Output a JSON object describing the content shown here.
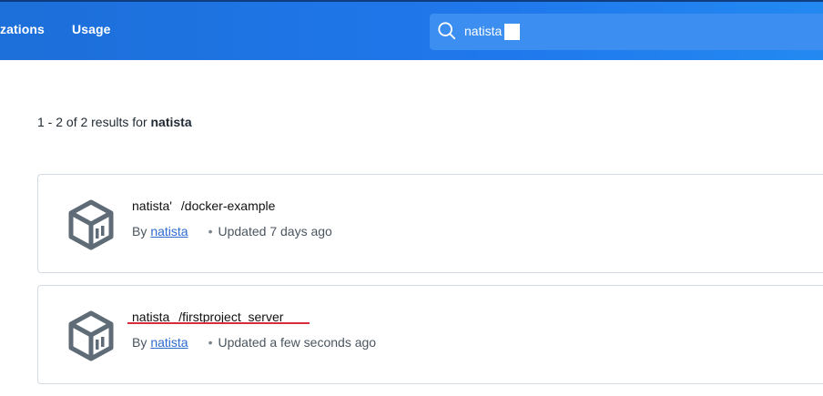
{
  "header": {
    "nav": [
      {
        "label": "zations"
      },
      {
        "label": "Usage"
      }
    ],
    "search": {
      "value": "natista"
    }
  },
  "summary": {
    "prefix": "1 - 2 of 2 results for",
    "query": "natista"
  },
  "results": [
    {
      "namespace": "natista'",
      "repo": "/docker-example",
      "by_label": "By",
      "author": "natista",
      "updated": "Updated 7 days ago"
    },
    {
      "namespace": "natista",
      "repo": "/firstproject_server",
      "by_label": "By",
      "author": "natista",
      "updated": "Updated a few seconds ago"
    }
  ],
  "colors": {
    "header": "#1f78ec",
    "link": "#2d6ad0",
    "annotation_underline": "#d92b3a"
  }
}
